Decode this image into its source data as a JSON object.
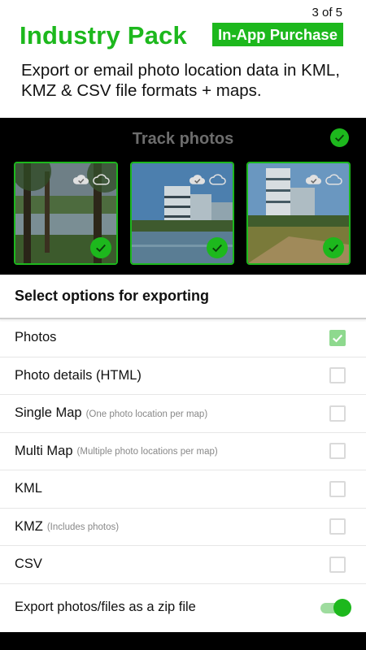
{
  "header": {
    "page_counter": "3 of 5",
    "title": "Industry Pack",
    "badge": "In-App Purchase",
    "subtitle": "Export or email photo location data in KML, KMZ & CSV file formats + maps."
  },
  "preview": {
    "title": "Track photos",
    "thumbnails": [
      {
        "name": "thumbnail-1",
        "selected": true
      },
      {
        "name": "thumbnail-2",
        "selected": true
      },
      {
        "name": "thumbnail-3",
        "selected": true
      }
    ]
  },
  "export_options": {
    "title": "Select options for exporting",
    "items": [
      {
        "label": "Photos",
        "hint": "",
        "checked": true
      },
      {
        "label": "Photo details (HTML)",
        "hint": "",
        "checked": false
      },
      {
        "label": "Single Map",
        "hint": "(One photo location per map)",
        "checked": false
      },
      {
        "label": "Multi Map",
        "hint": "(Multiple photo locations per map)",
        "checked": false
      },
      {
        "label": "KML",
        "hint": "",
        "checked": false
      },
      {
        "label": "KMZ",
        "hint": "(Includes photos)",
        "checked": false
      },
      {
        "label": "CSV",
        "hint": "",
        "checked": false
      }
    ],
    "zip": {
      "label": "Export photos/files as a zip file",
      "enabled": true
    }
  },
  "colors": {
    "accent": "#1db81d",
    "checked_box": "#8ed98e",
    "toggle_track": "#9edc9e"
  }
}
